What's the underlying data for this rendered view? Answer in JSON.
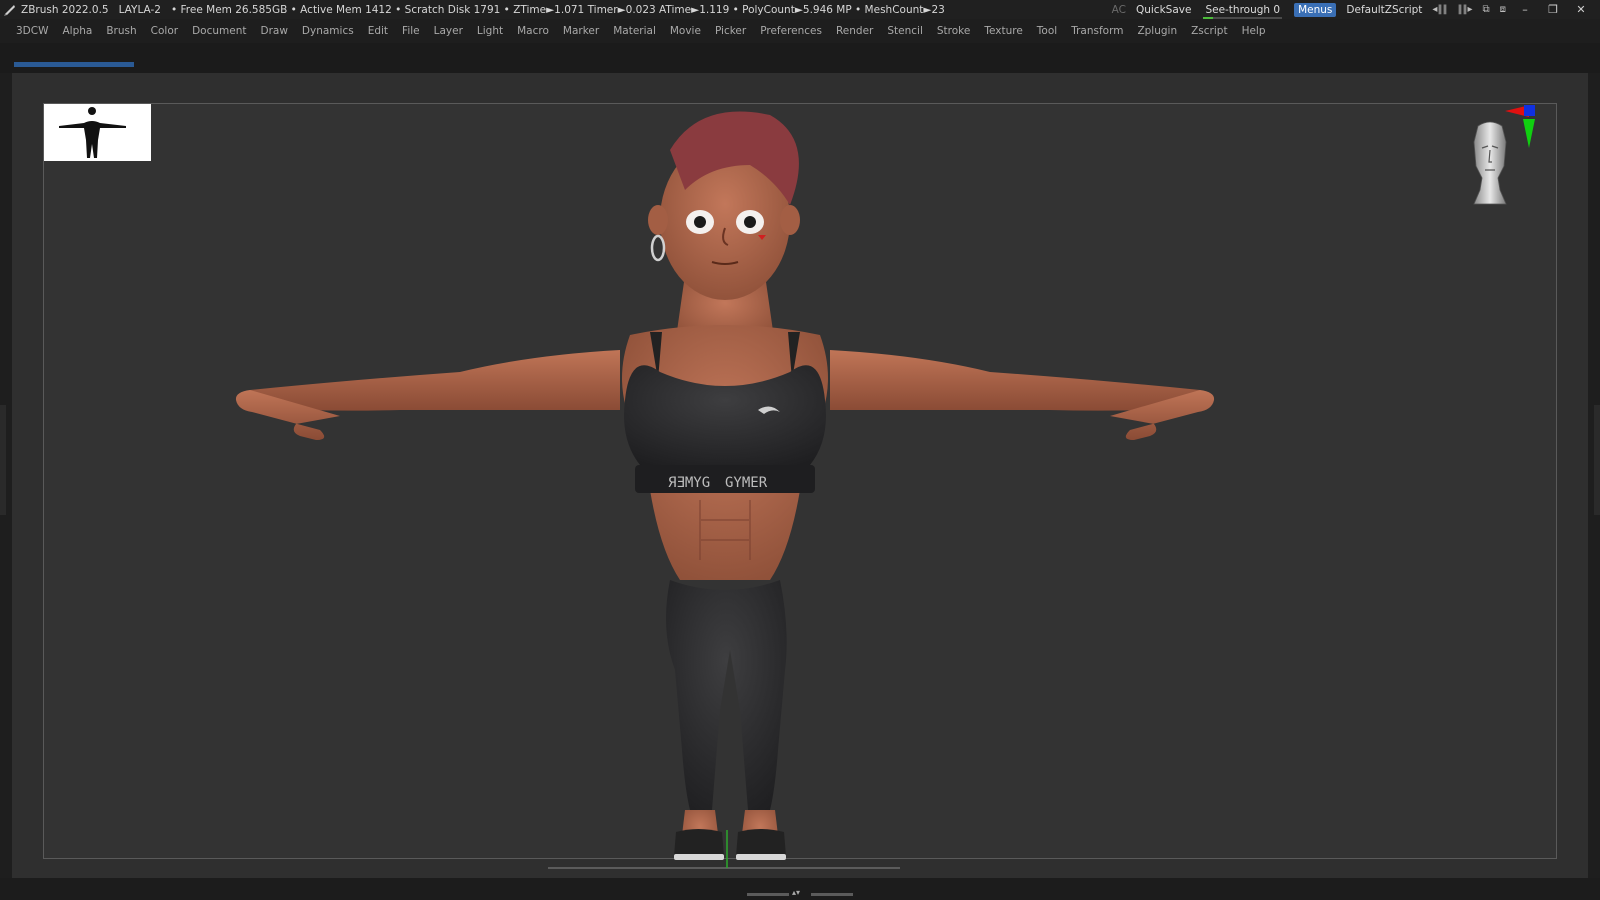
{
  "titlebar": {
    "app": "ZBrush 2022.0.5",
    "document": "LAYLA-2",
    "stats": "• Free Mem 26.585GB • Active Mem 1412 • Scratch Disk 1791 •  ZTime►1.071 Timer►0.023 ATime►1.119 • PolyCount►5.946 MP  • MeshCount►23",
    "ac": "AC",
    "quicksave": "QuickSave",
    "seethrough": "See-through  0",
    "seethrough_value": 0,
    "menus": "Menus",
    "default_zscript": "DefaultZScript"
  },
  "menubar": {
    "items": [
      "3DCW",
      "Alpha",
      "Brush",
      "Color",
      "Document",
      "Draw",
      "Dynamics",
      "Edit",
      "File",
      "Layer",
      "Light",
      "Macro",
      "Marker",
      "Material",
      "Movie",
      "Picker",
      "Preferences",
      "Render",
      "Stencil",
      "Stroke",
      "Texture",
      "Tool",
      "Transform",
      "Zplugin",
      "Zscript",
      "Help"
    ]
  },
  "model": {
    "top_band_text_left": "ЯƎMYG",
    "top_band_text_right": "GYMER"
  },
  "colors": {
    "accent": "#3a6fb5",
    "progress": "#2a5a95",
    "skin": "#a9654a",
    "hair": "#8a3b3f",
    "cloth": "#2a2a2c",
    "axis_x": "#e01010",
    "axis_y": "#10d010",
    "axis_z": "#1030e0"
  },
  "icons": {
    "logo": "zbrush-logo-icon",
    "minimize": "minimize-icon",
    "restore": "restore-icon",
    "close": "close-icon"
  }
}
